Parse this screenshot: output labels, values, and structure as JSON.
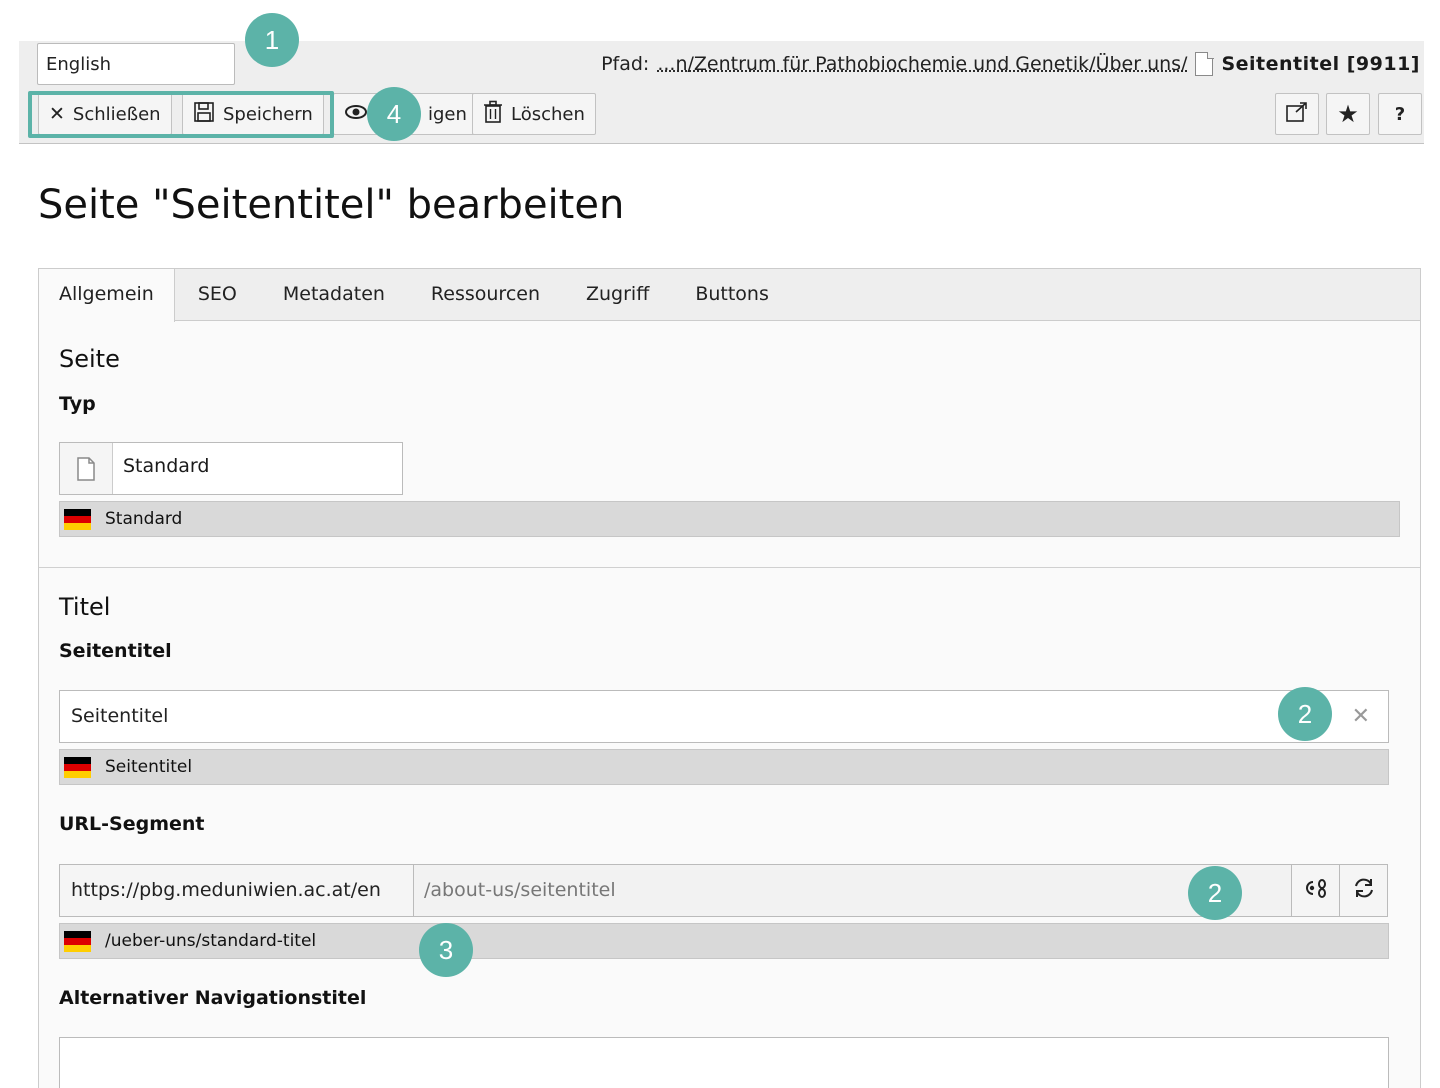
{
  "header": {
    "language": "English",
    "path_label": "Pfad:",
    "path_link": "...n/Zentrum für Pathobiochemie und Genetik/Über uns/",
    "page_title": "Seitentitel [9911]"
  },
  "toolbar": {
    "close_label": "Schließen",
    "save_label": "Speichern",
    "view_label": "Anzeigen",
    "view_visible": "igen",
    "delete_label": "Löschen",
    "help_label": "?"
  },
  "markers": [
    "1",
    "4",
    "2",
    "2",
    "3"
  ],
  "title": "Seite \"Seitentitel\" bearbeiten",
  "tabs": [
    {
      "label": "Allgemein",
      "active": true
    },
    {
      "label": "SEO"
    },
    {
      "label": "Metadaten"
    },
    {
      "label": "Ressourcen"
    },
    {
      "label": "Zugriff"
    },
    {
      "label": "Buttons"
    }
  ],
  "sections": {
    "seite": {
      "title": "Seite",
      "typ_label": "Typ",
      "typ_value": "Standard",
      "typ_reference": "Standard"
    },
    "titel": {
      "title": "Titel",
      "seitentitel_label": "Seitentitel",
      "seitentitel_value": "Seitentitel",
      "seitentitel_reference": "Seitentitel",
      "url_label": "URL-Segment",
      "url_prefix": "https://pbg.meduniwien.ac.at/en",
      "url_value": "/about-us/seitentitel",
      "url_reference": "/ueber-uns/standard-titel",
      "nav_title_label": "Alternativer Navigationstitel",
      "nav_title_value": ""
    }
  },
  "colors": {
    "accent_marker": "#5cb3a8",
    "header_bg": "#eeeeee",
    "reference_bg": "#d9d9d9"
  }
}
